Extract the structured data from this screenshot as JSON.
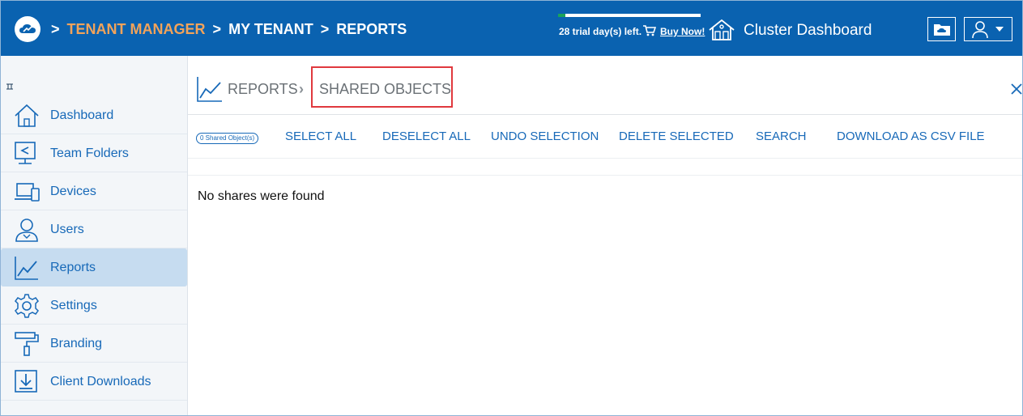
{
  "header": {
    "breadcrumb": [
      {
        "sep": ">",
        "label": "TENANT MANAGER"
      },
      {
        "sep": ">",
        "label": "MY TENANT"
      },
      {
        "sep": ">",
        "label": "REPORTS"
      }
    ],
    "trial_text": "28 trial day(s) left.",
    "trial_progress": 0.05,
    "buy_label": "Buy Now!",
    "cluster_label": "Cluster Dashboard",
    "icons": [
      "cloud-logo-icon",
      "cart-icon",
      "cluster-home-icon",
      "cloud-folder-icon",
      "user-menu-icon"
    ],
    "colors": {
      "bar": "#0a62b0",
      "accent": "#f2a35a",
      "progress": "#19a35a"
    }
  },
  "sidebar": {
    "items": [
      {
        "label": "Dashboard",
        "icon": "home-icon"
      },
      {
        "label": "Team Folders",
        "icon": "team-folders-icon"
      },
      {
        "label": "Devices",
        "icon": "devices-icon"
      },
      {
        "label": "Users",
        "icon": "users-icon"
      },
      {
        "label": "Reports",
        "icon": "reports-icon",
        "active": true
      },
      {
        "label": "Settings",
        "icon": "settings-icon"
      },
      {
        "label": "Branding",
        "icon": "branding-icon"
      },
      {
        "label": "Client Downloads",
        "icon": "client-downloads-icon"
      }
    ]
  },
  "page": {
    "parent": "REPORTS",
    "current": "SHARED OBJECTS",
    "count_badge": "0 Shared Object(s)",
    "toolbar": {
      "select_all": "SELECT ALL",
      "deselect_all": "DESELECT ALL",
      "undo_selection": "UNDO SELECTION",
      "delete_selected": "DELETE SELECTED",
      "search": "SEARCH",
      "download_csv": "DOWNLOAD AS CSV FILE"
    },
    "empty_message": "No shares were found"
  }
}
